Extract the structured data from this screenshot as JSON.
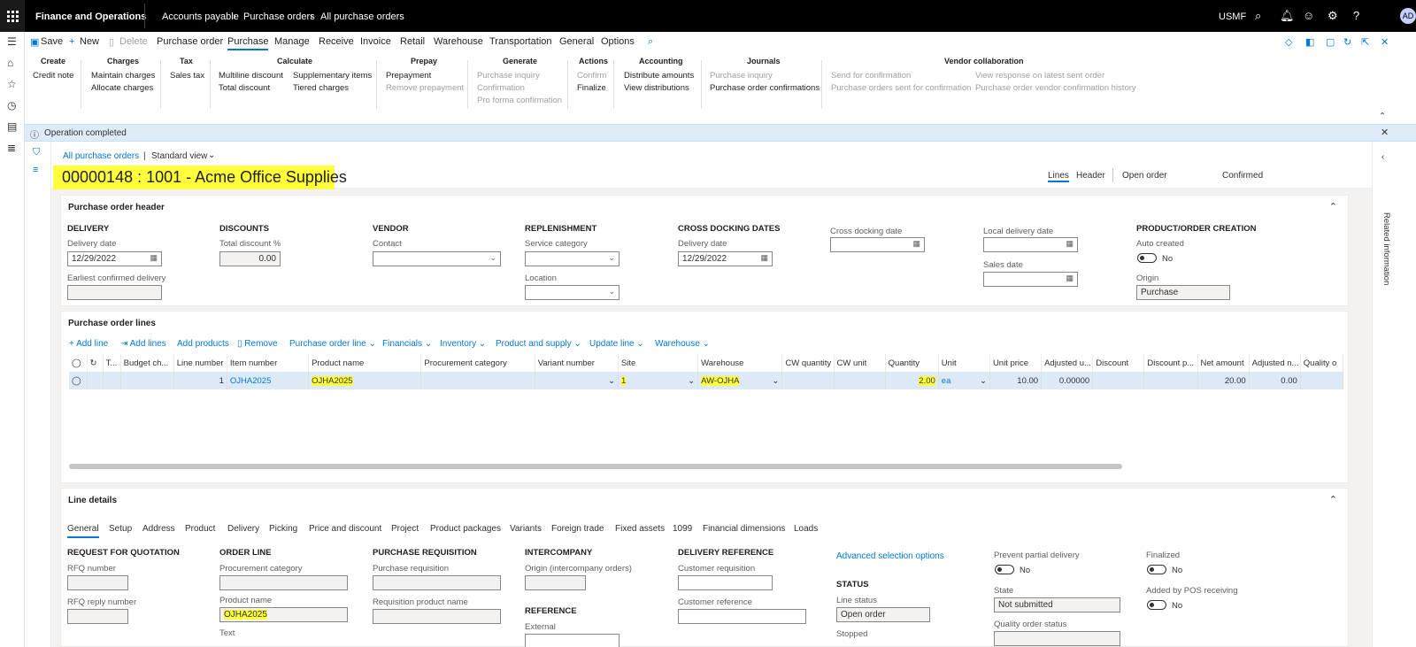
{
  "topbar": {
    "app_title": "Finance and Operations",
    "breadcrumb": [
      "Accounts payable",
      "Purchase orders",
      "All purchase orders"
    ],
    "company": "USMF",
    "avatar": "AD"
  },
  "actions": {
    "save": "Save",
    "new": "New",
    "delete": "Delete",
    "tabs": [
      "Purchase order",
      "Purchase",
      "Manage",
      "Receive",
      "Invoice",
      "Retail",
      "Warehouse",
      "Transportation",
      "General",
      "Options"
    ]
  },
  "ribbon": {
    "create": {
      "title": "Create",
      "items": [
        "Credit note"
      ]
    },
    "charges": {
      "title": "Charges",
      "items": [
        "Maintain charges",
        "Allocate charges"
      ]
    },
    "tax": {
      "title": "Tax",
      "items": [
        "Sales tax"
      ]
    },
    "calculate": {
      "title": "Calculate",
      "items": [
        "Multiline discount",
        "Total discount",
        "Supplementary items",
        "Tiered charges"
      ]
    },
    "prepay": {
      "title": "Prepay",
      "items": [
        "Prepayment",
        "Remove prepayment"
      ]
    },
    "generate": {
      "title": "Generate",
      "items": [
        "Purchase inquiry",
        "Confirmation",
        "Pro forma confirmation"
      ]
    },
    "actions": {
      "title": "Actions",
      "items": [
        "Confirm",
        "Finalize"
      ]
    },
    "accounting": {
      "title": "Accounting",
      "items": [
        "Distribute amounts",
        "View distributions"
      ]
    },
    "journals": {
      "title": "Journals",
      "items": [
        "Purchase inquiry",
        "Purchase order confirmations"
      ]
    },
    "vendor_collab": {
      "title": "Vendor collaboration",
      "items": [
        "Send for confirmation",
        "Purchase orders sent for confirmation",
        "View response on latest sent order",
        "Purchase order vendor confirmation history"
      ]
    }
  },
  "message": "Operation completed",
  "page": {
    "list_link": "All purchase orders",
    "view": "Standard view",
    "title": "00000148 : 1001 - Acme Office Supplies",
    "lines_tab": "Lines",
    "header_tab": "Header",
    "status1": "Open order",
    "status2": "Confirmed",
    "related_info": "Related information"
  },
  "po_header": {
    "title": "Purchase order header",
    "delivery": {
      "heading": "DELIVERY",
      "delivery_date_label": "Delivery date",
      "delivery_date": "12/29/2022",
      "earliest_label": "Earliest confirmed delivery"
    },
    "discounts": {
      "heading": "DISCOUNTS",
      "total_label": "Total discount %",
      "total": "0.00"
    },
    "vendor": {
      "heading": "VENDOR",
      "contact_label": "Contact"
    },
    "replenishment": {
      "heading": "REPLENISHMENT",
      "service_label": "Service category",
      "location_label": "Location"
    },
    "cross_docking": {
      "heading": "CROSS DOCKING DATES",
      "delivery_date_label": "Delivery date",
      "delivery_date": "12/29/2022",
      "cross_label": "Cross docking date"
    },
    "local": {
      "local_label": "Local delivery date",
      "sales_label": "Sales date"
    },
    "creation": {
      "heading": "PRODUCT/ORDER CREATION",
      "auto_label": "Auto created",
      "auto_value": "No",
      "origin_label": "Origin",
      "origin": "Purchase"
    }
  },
  "lines": {
    "title": "Purchase order lines",
    "toolbar": [
      "Add line",
      "Add lines",
      "Add products",
      "Remove",
      "Purchase order line",
      "Financials",
      "Inventory",
      "Product and supply",
      "Update line",
      "Warehouse"
    ],
    "columns": [
      "",
      "",
      "T...",
      "Budget ch...",
      "Line number",
      "Item number",
      "Product name",
      "Procurement category",
      "Variant number",
      "Site",
      "Warehouse",
      "CW quantity",
      "CW unit",
      "Quantity",
      "Unit",
      "Unit price",
      "Adjusted u...",
      "Discount",
      "Discount p...",
      "Net amount",
      "Adjusted n...",
      "Quality o"
    ],
    "row": {
      "line_number": "1",
      "item_number": "OJHA2025",
      "product_name": "OJHA2025",
      "site": "1",
      "warehouse": "AW-OJHA",
      "quantity": "2.00",
      "unit": "ea",
      "unit_price": "10.00",
      "adjusted_unit": "0.00000",
      "net_amount": "20.00",
      "adjusted_net": "0.00"
    }
  },
  "line_details": {
    "title": "Line details",
    "tabs": [
      "General",
      "Setup",
      "Address",
      "Product",
      "Delivery",
      "Picking",
      "Price and discount",
      "Project",
      "Product packages",
      "Variants",
      "Foreign trade",
      "Fixed assets",
      "1099",
      "Financial dimensions",
      "Loads"
    ],
    "rfq": {
      "heading": "REQUEST FOR QUOTATION",
      "rfq_number_label": "RFQ number",
      "rfq_reply_label": "RFQ reply number"
    },
    "order_line": {
      "heading": "ORDER LINE",
      "proc_label": "Procurement category",
      "product_label": "Product name",
      "product_name": "OJHA2025",
      "text_label": "Text"
    },
    "purch_req": {
      "heading": "PURCHASE REQUISITION",
      "req_label": "Purchase requisition",
      "req_product_label": "Requisition product name"
    },
    "intercompany": {
      "heading": "INTERCOMPANY",
      "origin_label": "Origin (intercompany orders)",
      "reference_heading": "REFERENCE",
      "external_label": "External"
    },
    "delivery_ref": {
      "heading": "DELIVERY REFERENCE",
      "cust_req_label": "Customer requisition",
      "cust_ref_label": "Customer reference"
    },
    "advanced": "Advanced selection options",
    "status": {
      "heading": "STATUS",
      "line_status_label": "Line status",
      "line_status": "Open order",
      "stopped_label": "Stopped"
    },
    "partial": {
      "label": "Prevent partial delivery",
      "value": "No",
      "state_label": "State",
      "state": "Not submitted",
      "quality_label": "Quality order status"
    },
    "finalized": {
      "label": "Finalized",
      "value": "No",
      "pos_label": "Added by POS receiving",
      "pos_value": "No"
    }
  }
}
